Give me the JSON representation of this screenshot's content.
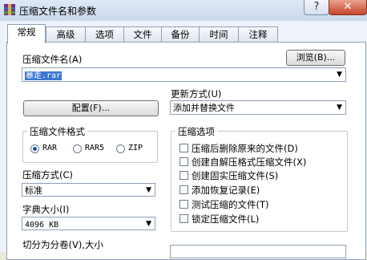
{
  "window": {
    "title": "压缩文件名和参数",
    "help_label": "?",
    "close_label": "✕"
  },
  "tabs": [
    {
      "label": "常规",
      "active": true
    },
    {
      "label": "高级",
      "active": false
    },
    {
      "label": "选项",
      "active": false
    },
    {
      "label": "文件",
      "active": false
    },
    {
      "label": "备份",
      "active": false
    },
    {
      "label": "时间",
      "active": false
    },
    {
      "label": "注释",
      "active": false
    }
  ],
  "general": {
    "archive_name_label": "压缩文件名(A)",
    "browse_label": "浏览(B)...",
    "archive_name_value": "暴走.rar",
    "update_mode_label": "更新方式(U)",
    "update_mode_value": "添加并替换文件",
    "profiles_label": "配置(F)...",
    "format_group_title": "压缩文件格式",
    "format_options": [
      {
        "label": "RAR",
        "selected": true
      },
      {
        "label": "RAR5",
        "selected": false
      },
      {
        "label": "ZIP",
        "selected": false
      }
    ],
    "method_label": "压缩方式(C)",
    "method_value": "标准",
    "dict_label": "字典大小(I)",
    "dict_value": "4096 KB",
    "split_label": "切分为分卷(V),大小",
    "options_group_title": "压缩选项",
    "options": [
      {
        "label": "压缩后删除原来的文件(D)",
        "checked": false
      },
      {
        "label": "创建自解压格式压缩文件(X)",
        "checked": false
      },
      {
        "label": "创建固实压缩文件(S)",
        "checked": false
      },
      {
        "label": "添加恢复记录(E)",
        "checked": false
      },
      {
        "label": "测试压缩的文件(T)",
        "checked": false
      },
      {
        "label": "锁定压缩文件(L)",
        "checked": false
      }
    ]
  }
}
